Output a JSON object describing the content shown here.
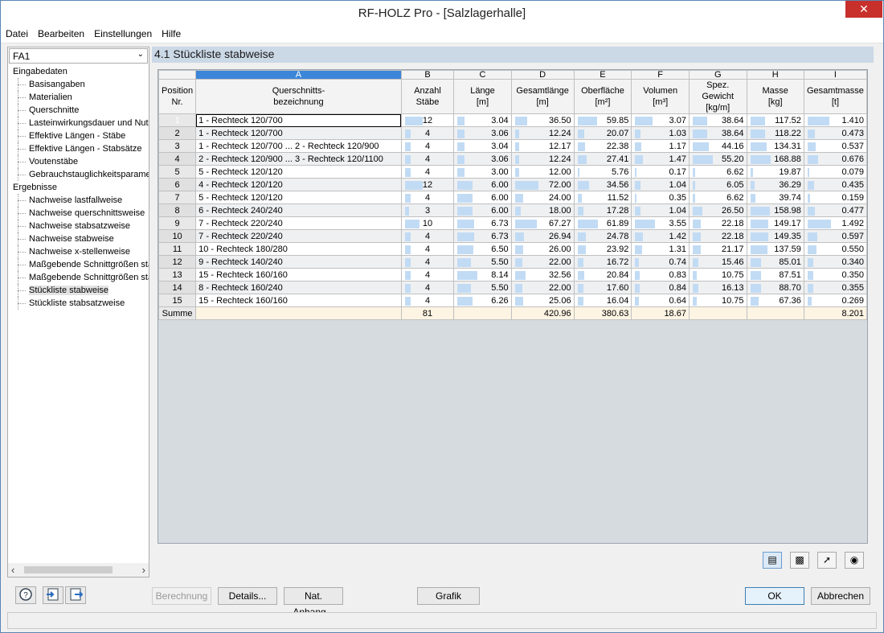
{
  "window": {
    "title": "RF-HOLZ Pro - [Salzlagerhalle]",
    "close_glyph": "✕"
  },
  "menu": [
    "Datei",
    "Bearbeiten",
    "Einstellungen",
    "Hilfe"
  ],
  "nav": {
    "case_select": "FA1",
    "groups": [
      {
        "label": "Eingabedaten",
        "items": [
          "Basisangaben",
          "Materialien",
          "Querschnitte",
          "Lasteinwirkungsdauer und Nutz",
          "Effektive Längen - Stäbe",
          "Effektive Längen - Stabsätze",
          "Voutenstäbe",
          "Gebrauchstauglichkeitsparamet"
        ]
      },
      {
        "label": "Ergebnisse",
        "items": [
          "Nachweise lastfallweise",
          "Nachweise querschnittsweise",
          "Nachweise stabsatzweise",
          "Nachweise stabweise",
          "Nachweise x-stellenweise",
          "Maßgebende Schnittgrößen sta",
          "Maßgebende Schnittgrößen sta",
          "Stückliste stabweise",
          "Stückliste stabsatzweise"
        ]
      }
    ],
    "selected": "Stückliste stabweise"
  },
  "section_title": "4.1 Stückliste stabweise",
  "table": {
    "col_letters": [
      "A",
      "B",
      "C",
      "D",
      "E",
      "F",
      "G",
      "H",
      "I"
    ],
    "pos_header": [
      "Position",
      "Nr."
    ],
    "headers": [
      [
        "Querschnitts-",
        "bezeichnung"
      ],
      [
        "Anzahl",
        "Stäbe"
      ],
      [
        "Länge",
        "[m]"
      ],
      [
        "Gesamtlänge",
        "[m]"
      ],
      [
        "Oberfläche",
        "[m²]"
      ],
      [
        "Volumen",
        "[m³]"
      ],
      [
        "Spez. Gewicht",
        "[kg/m]"
      ],
      [
        "Masse",
        "[kg]"
      ],
      [
        "Gesamtmasse",
        "[t]"
      ]
    ],
    "rows": [
      {
        "pos": "1",
        "section": "1 - Rechteck 120/700",
        "count": "12",
        "length": "3.04",
        "total_length": "36.50",
        "surface": "59.85",
        "volume": "3.07",
        "weight": "38.64",
        "mass": "117.52",
        "total_mass": "1.410"
      },
      {
        "pos": "2",
        "section": "1 - Rechteck 120/700",
        "count": "4",
        "length": "3.06",
        "total_length": "12.24",
        "surface": "20.07",
        "volume": "1.03",
        "weight": "38.64",
        "mass": "118.22",
        "total_mass": "0.473"
      },
      {
        "pos": "3",
        "section": "1 - Rechteck 120/700 ... 2 - Rechteck 120/900",
        "count": "4",
        "length": "3.04",
        "total_length": "12.17",
        "surface": "22.38",
        "volume": "1.17",
        "weight": "44.16",
        "mass": "134.31",
        "total_mass": "0.537"
      },
      {
        "pos": "4",
        "section": "2 - Rechteck 120/900 ... 3 - Rechteck 120/1100",
        "count": "4",
        "length": "3.06",
        "total_length": "12.24",
        "surface": "27.41",
        "volume": "1.47",
        "weight": "55.20",
        "mass": "168.88",
        "total_mass": "0.676"
      },
      {
        "pos": "5",
        "section": "5 - Rechteck 120/120",
        "count": "4",
        "length": "3.00",
        "total_length": "12.00",
        "surface": "5.76",
        "volume": "0.17",
        "weight": "6.62",
        "mass": "19.87",
        "total_mass": "0.079"
      },
      {
        "pos": "6",
        "section": "4 - Rechteck 120/120",
        "count": "12",
        "length": "6.00",
        "total_length": "72.00",
        "surface": "34.56",
        "volume": "1.04",
        "weight": "6.05",
        "mass": "36.29",
        "total_mass": "0.435"
      },
      {
        "pos": "7",
        "section": "5 - Rechteck 120/120",
        "count": "4",
        "length": "6.00",
        "total_length": "24.00",
        "surface": "11.52",
        "volume": "0.35",
        "weight": "6.62",
        "mass": "39.74",
        "total_mass": "0.159"
      },
      {
        "pos": "8",
        "section": "6 - Rechteck 240/240",
        "count": "3",
        "length": "6.00",
        "total_length": "18.00",
        "surface": "17.28",
        "volume": "1.04",
        "weight": "26.50",
        "mass": "158.98",
        "total_mass": "0.477"
      },
      {
        "pos": "9",
        "section": "7 - Rechteck 220/240",
        "count": "10",
        "length": "6.73",
        "total_length": "67.27",
        "surface": "61.89",
        "volume": "3.55",
        "weight": "22.18",
        "mass": "149.17",
        "total_mass": "1.492"
      },
      {
        "pos": "10",
        "section": "7 - Rechteck 220/240",
        "count": "4",
        "length": "6.73",
        "total_length": "26.94",
        "surface": "24.78",
        "volume": "1.42",
        "weight": "22.18",
        "mass": "149.35",
        "total_mass": "0.597"
      },
      {
        "pos": "11",
        "section": "10 - Rechteck 180/280",
        "count": "4",
        "length": "6.50",
        "total_length": "26.00",
        "surface": "23.92",
        "volume": "1.31",
        "weight": "21.17",
        "mass": "137.59",
        "total_mass": "0.550"
      },
      {
        "pos": "12",
        "section": "9 - Rechteck 140/240",
        "count": "4",
        "length": "5.50",
        "total_length": "22.00",
        "surface": "16.72",
        "volume": "0.74",
        "weight": "15.46",
        "mass": "85.01",
        "total_mass": "0.340"
      },
      {
        "pos": "13",
        "section": "15 - Rechteck 160/160",
        "count": "4",
        "length": "8.14",
        "total_length": "32.56",
        "surface": "20.84",
        "volume": "0.83",
        "weight": "10.75",
        "mass": "87.51",
        "total_mass": "0.350"
      },
      {
        "pos": "14",
        "section": "8 - Rechteck 160/240",
        "count": "4",
        "length": "5.50",
        "total_length": "22.00",
        "surface": "17.60",
        "volume": "0.84",
        "weight": "16.13",
        "mass": "88.70",
        "total_mass": "0.355"
      },
      {
        "pos": "15",
        "section": "15 - Rechteck 160/160",
        "count": "4",
        "length": "6.26",
        "total_length": "25.06",
        "surface": "16.04",
        "volume": "0.64",
        "weight": "10.75",
        "mass": "67.36",
        "total_mass": "0.269"
      }
    ],
    "sum": {
      "label": "Summe",
      "count": "81",
      "total_length": "420.96",
      "surface": "380.63",
      "volume": "18.67",
      "total_mass": "8.201"
    }
  },
  "toolbar_icons": [
    "table-settings-icon",
    "export-excel-icon",
    "select-pointer-icon",
    "view-eye-icon"
  ],
  "footer": {
    "berechnung": "Berechnung",
    "details": "Details...",
    "nat_anhang": "Nat. Anhang...",
    "grafik": "Grafik",
    "ok": "OK",
    "abbrechen": "Abbrechen"
  }
}
